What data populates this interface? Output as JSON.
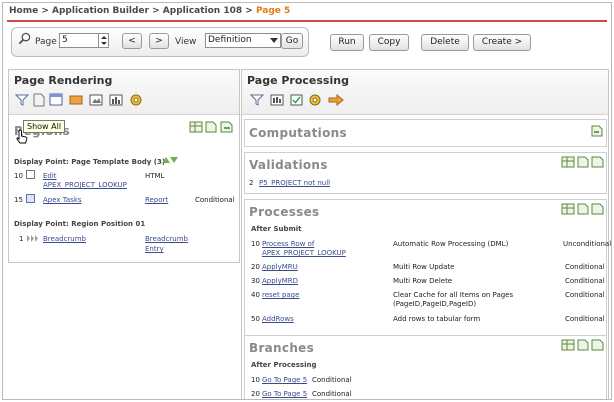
{
  "breadcrumb": {
    "home": "Home",
    "sep": " > ",
    "builder": "Application Builder",
    "app": "Application 108",
    "current": "Page 5"
  },
  "toolbar": {
    "page_label": "Page",
    "page_value": "5",
    "prev_label": "<",
    "next_label": ">",
    "view_label": "View",
    "view_value": "Definition",
    "go_label": "Go"
  },
  "actions": {
    "run": "Run",
    "copy": "Copy",
    "delete": "Delete",
    "create": "Create >"
  },
  "rendering": {
    "title": "Page Rendering",
    "tooltip": "Show All",
    "regions_title": "Regions",
    "dp1": "Display Point: Page Template Body (3)",
    "rows": [
      {
        "seq": "10",
        "edit": "Edit",
        "name": "APEX_PROJECT_LOOKUP",
        "type": "HTML",
        "cond": ""
      },
      {
        "seq": "15",
        "edit": "",
        "name": "Apex Tasks",
        "type": "Report",
        "cond": "Conditional"
      }
    ],
    "dp2": "Display Point: Region Position 01",
    "row3": {
      "seq": "1",
      "name": "Breadcrumb",
      "type": "Breadcrumb",
      "type2": "Entry"
    }
  },
  "processing": {
    "title": "Page Processing",
    "computations": "Computations",
    "validations": "Validations",
    "validation_row": {
      "seq": "2",
      "name": "P5_PROJECT not null"
    },
    "processes": "Processes",
    "after_submit": "After Submit",
    "process_rows": [
      {
        "seq": "10",
        "name": "Process Row of",
        "name2": "APEX_PROJECT_LOOKUP",
        "desc": "Automatic Row Processing (DML)",
        "desc2": "",
        "desc3": "",
        "cond": "Unconditional"
      },
      {
        "seq": "20",
        "name": "ApplyMRU",
        "name2": "",
        "desc": "Multi Row Update",
        "desc2": "",
        "desc3": "",
        "cond": "Conditional"
      },
      {
        "seq": "30",
        "name": "ApplyMRD",
        "name2": "",
        "desc": "Multi Row Delete",
        "desc2": "",
        "desc3": "",
        "cond": "Conditional"
      },
      {
        "seq": "40",
        "name": "reset page",
        "name2": "",
        "desc": "Clear Cache for all Items on Pages",
        "desc2": "(PageID,PageID,PageID)",
        "desc3": "",
        "cond": "Conditional"
      },
      {
        "seq": "50",
        "name": "AddRows",
        "name2": "",
        "desc": "Add rows to tabular form",
        "desc2": "",
        "desc3": "",
        "cond": "Conditional"
      }
    ],
    "branches": "Branches",
    "after_processing": "After Processing",
    "branch_rows": [
      {
        "seq": "10",
        "name": "Go To Page 5",
        "cond": "Conditional"
      },
      {
        "seq": "20",
        "name": "Go To Page 5",
        "cond": "Conditional"
      }
    ]
  },
  "colors": {
    "accent": "#e47b13",
    "rule": "#d04a4a",
    "link": "#3b4b8c"
  }
}
